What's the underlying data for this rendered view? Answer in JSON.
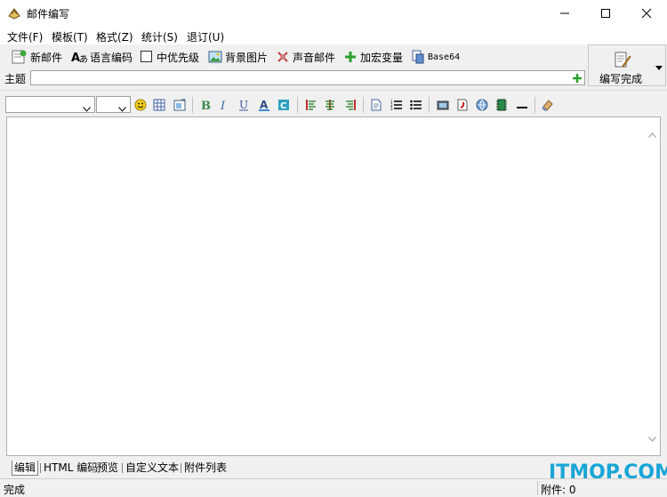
{
  "window": {
    "title": "邮件编写",
    "controls": [
      "minimize",
      "maximize",
      "close"
    ]
  },
  "menu": [
    {
      "label": "文件(F)"
    },
    {
      "label": "模板(T)"
    },
    {
      "label": "格式(Z)"
    },
    {
      "label": "统计(S)"
    },
    {
      "label": "退订(U)"
    }
  ],
  "toolbar": {
    "new_mail": "新邮件",
    "language_encoding": "语言编码",
    "medium_priority": "中优先级",
    "background_image": "背景图片",
    "sound_mail": "声音邮件",
    "add_macro_variable": "加宏变量",
    "base64": "Base64",
    "compose_done": "编写完成"
  },
  "subject": {
    "label": "主题",
    "value": ""
  },
  "format_toolbar": {
    "font_name": "",
    "font_size": ""
  },
  "tabs": [
    {
      "label": "编辑",
      "active": true
    },
    {
      "label": "HTML 编码",
      "active": false
    },
    {
      "label": "预览",
      "active": false
    },
    {
      "label": "自定义文本",
      "active": false
    },
    {
      "label": "附件列表",
      "active": false
    }
  ],
  "status": {
    "text": "完成",
    "attachments": "附件: 0"
  },
  "watermark": "ITMOP.COM",
  "colors": {
    "accent": "#19a6d6",
    "window_bg": "#f0f0f0"
  }
}
